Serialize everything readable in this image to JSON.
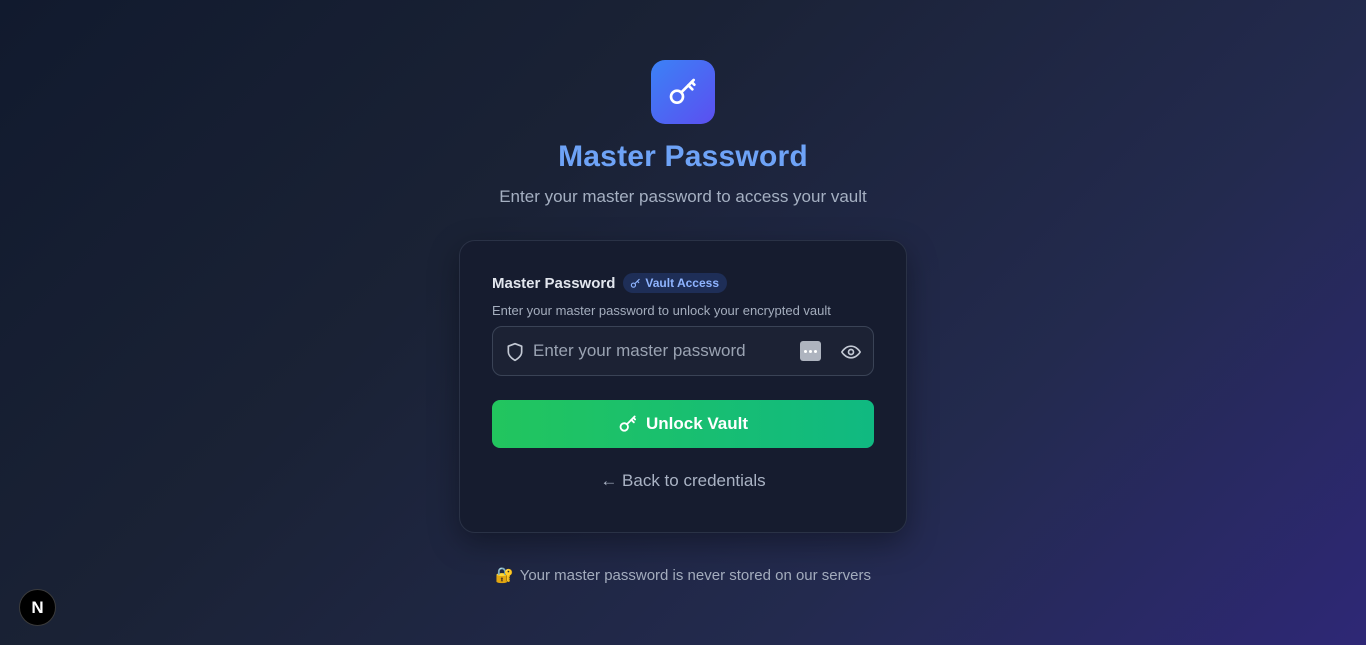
{
  "header": {
    "logo_icon": "key-icon",
    "title": "Master Password",
    "subtitle": "Enter your master password to access your vault"
  },
  "form": {
    "label": "Master Password",
    "badge": "Vault Access",
    "helper": "Enter your master password to unlock your encrypted vault",
    "input_placeholder": "Enter your master password",
    "input_value": "",
    "unlock_label": "Unlock Vault",
    "back_label": "← Back to credentials"
  },
  "footer": {
    "note": "Your master password is never stored on our servers",
    "note_icon": "🔐"
  },
  "dev_badge": {
    "letter": "N"
  },
  "colors": {
    "accent_blue": "#6ea3f7",
    "button_green": "#22c55e",
    "card_bg": "#161c2f"
  }
}
